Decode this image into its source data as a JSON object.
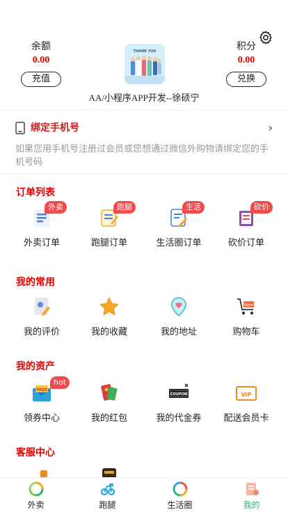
{
  "header": {
    "balance_label": "余额",
    "balance_value": "0.00",
    "recharge_button": "充值",
    "points_label": "积分",
    "points_value": "0.00",
    "exchange_button": "兑换",
    "shop_name": "AA/小程序APP开发--徐硕宁",
    "avatar_text": "THANK YOU"
  },
  "bind_phone": {
    "title": "绑定手机号",
    "description": "如果您用手机号注册过会员或您想通过微信外购物请绑定您的手机号码"
  },
  "orders": {
    "title": "订单列表",
    "items": [
      {
        "label": "外卖订单",
        "badge": "外卖"
      },
      {
        "label": "跑腿订单",
        "badge": "跑腿"
      },
      {
        "label": "生活圈订单",
        "badge": "生活"
      },
      {
        "label": "砍价订单",
        "badge": "砍价"
      }
    ]
  },
  "common": {
    "title": "我的常用",
    "items": [
      {
        "label": "我的评价"
      },
      {
        "label": "我的收藏"
      },
      {
        "label": "我的地址"
      },
      {
        "label": "购物车"
      }
    ]
  },
  "assets": {
    "title": "我的资产",
    "items": [
      {
        "label": "领券中心",
        "badge": "hot"
      },
      {
        "label": "我的红包"
      },
      {
        "label": "我的代金券"
      },
      {
        "label": "配送会员卡"
      }
    ]
  },
  "service": {
    "title": "客服中心"
  },
  "tabbar": {
    "items": [
      {
        "label": "外卖"
      },
      {
        "label": "跑腿"
      },
      {
        "label": "生活圈"
      },
      {
        "label": "我的"
      }
    ],
    "active": "我的"
  },
  "colors": {
    "accent_red": "#e00000",
    "badge_red": "#f04a4a",
    "active_green": "#2bb673"
  }
}
